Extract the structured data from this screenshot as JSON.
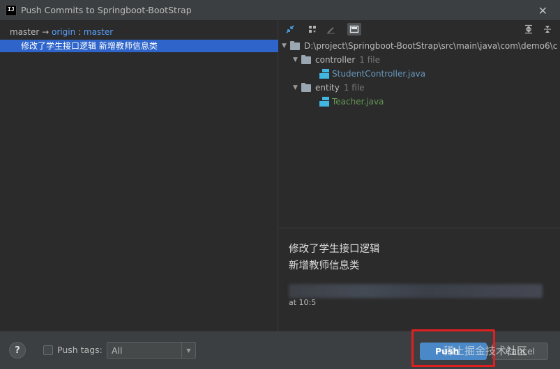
{
  "window": {
    "title": "Push Commits to Springboot-BootStrap",
    "app_icon_text": "IJ"
  },
  "left_pane": {
    "branch_local": "master",
    "branch_arrow": "→",
    "branch_remote": "origin",
    "branch_sep": ":",
    "branch_target": "master",
    "commit_message": "修改了学生接口逻辑 新增教师信息类"
  },
  "tree": {
    "root_path": "D:\\project\\Springboot-BootStrap\\src\\main\\java\\com\\demo6\\c",
    "nodes": [
      {
        "name": "controller",
        "count": "1 file",
        "files": [
          "StudentController.java"
        ]
      },
      {
        "name": "entity",
        "count": "1 file",
        "files": [
          "Teacher.java"
        ]
      }
    ]
  },
  "details": {
    "line1": "修改了学生接口逻辑",
    "line2": "新增教师信息类",
    "timestamp": "at 10:5"
  },
  "bottom": {
    "help_label": "?",
    "push_tags_label": "Push tags:",
    "push_tags_value": "All",
    "push_label": "Push",
    "cancel_label": "Cancel",
    "watermark": "稀土掘金技术社区"
  },
  "colors": {
    "accent": "#4a88c7",
    "selection": "#2f65ca",
    "highlight_box": "#e02020"
  }
}
